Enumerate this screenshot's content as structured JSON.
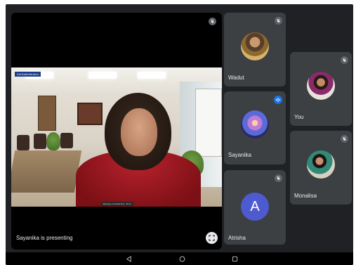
{
  "presenter": {
    "caption": "Sayanika is presenting",
    "brand": "VerSatileMotion",
    "name_strip": "Banerjee, Anindita M.A., M.Sc."
  },
  "participants": [
    {
      "name": "Wadut",
      "muted": true,
      "avatar": "photo"
    },
    {
      "name": "You",
      "muted": true,
      "avatar": "photo"
    },
    {
      "name": "Sayanika",
      "muted": false,
      "speaking": true,
      "avatar": "photo"
    },
    {
      "name": "Monalisa",
      "muted": true,
      "avatar": "photo"
    },
    {
      "name": "Atrisha",
      "muted": true,
      "avatar": "letter",
      "letter": "A"
    }
  ],
  "icons": {
    "mute": "mic-off-icon",
    "speaking": "audio-wave-icon",
    "fullscreen": "fullscreen-icon",
    "nav": [
      "back-icon",
      "home-icon",
      "recents-icon"
    ]
  },
  "colors": {
    "background": "#202124",
    "tile": "#3c4043",
    "letter_avatar": "#4e5bd0",
    "speaking": "#1a73e8"
  }
}
